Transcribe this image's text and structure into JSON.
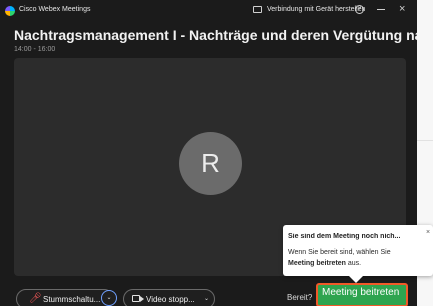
{
  "titlebar": {
    "app_name": "Cisco Webex Meetings",
    "device_link": "Verbindung mit Gerät herstellen",
    "help_symbol": "?",
    "close_symbol": "×"
  },
  "meeting": {
    "title": "Nachtragsmanagement I - Nachträge und deren Vergütung nach VOB/B",
    "time": "14:00 - 16:00",
    "avatar_initial": "R"
  },
  "controls": {
    "mute_label": "Stummschaltu...",
    "video_label": "Video stopp...",
    "ready_label": "Bereit?",
    "join_label": "Meeting beitreten",
    "caret": "⌄"
  },
  "popup": {
    "title": "Sie sind dem Meeting noch nich...",
    "close_symbol": "×",
    "line1": "Wenn Sie bereit sind, wählen Sie",
    "line2_bold": "Meeting beitreten",
    "line2_rest": " aus."
  },
  "icons": {
    "app": "webex-logo-icon",
    "device": "device-icon",
    "help": "help-icon",
    "minimize": "minimize-icon",
    "close": "close-icon",
    "mute": "microphone-muted-icon",
    "video": "video-camera-icon",
    "caret": "chevron-down-icon"
  },
  "colors": {
    "window_bg": "#1b1b1b",
    "video_bg": "#2c2c2c",
    "avatar_bg": "#6b6b6b",
    "join_button": "#2ea44f",
    "join_border": "#f05a28",
    "mute_icon": "#ff5a5a",
    "focus_ring": "#6fa0ff"
  }
}
